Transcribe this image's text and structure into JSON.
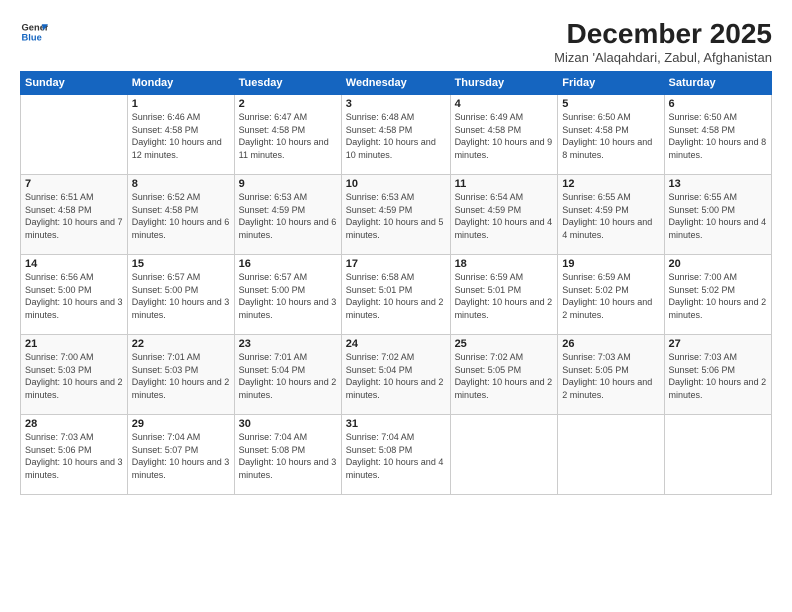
{
  "logo": {
    "line1": "General",
    "line2": "Blue"
  },
  "title": "December 2025",
  "subtitle": "Mizan 'Alaqahdari, Zabul, Afghanistan",
  "days_header": [
    "Sunday",
    "Monday",
    "Tuesday",
    "Wednesday",
    "Thursday",
    "Friday",
    "Saturday"
  ],
  "weeks": [
    [
      {
        "day": "",
        "sunrise": "",
        "sunset": "",
        "daylight": ""
      },
      {
        "day": "1",
        "sunrise": "Sunrise: 6:46 AM",
        "sunset": "Sunset: 4:58 PM",
        "daylight": "Daylight: 10 hours and 12 minutes."
      },
      {
        "day": "2",
        "sunrise": "Sunrise: 6:47 AM",
        "sunset": "Sunset: 4:58 PM",
        "daylight": "Daylight: 10 hours and 11 minutes."
      },
      {
        "day": "3",
        "sunrise": "Sunrise: 6:48 AM",
        "sunset": "Sunset: 4:58 PM",
        "daylight": "Daylight: 10 hours and 10 minutes."
      },
      {
        "day": "4",
        "sunrise": "Sunrise: 6:49 AM",
        "sunset": "Sunset: 4:58 PM",
        "daylight": "Daylight: 10 hours and 9 minutes."
      },
      {
        "day": "5",
        "sunrise": "Sunrise: 6:50 AM",
        "sunset": "Sunset: 4:58 PM",
        "daylight": "Daylight: 10 hours and 8 minutes."
      },
      {
        "day": "6",
        "sunrise": "Sunrise: 6:50 AM",
        "sunset": "Sunset: 4:58 PM",
        "daylight": "Daylight: 10 hours and 8 minutes."
      }
    ],
    [
      {
        "day": "7",
        "sunrise": "Sunrise: 6:51 AM",
        "sunset": "Sunset: 4:58 PM",
        "daylight": "Daylight: 10 hours and 7 minutes."
      },
      {
        "day": "8",
        "sunrise": "Sunrise: 6:52 AM",
        "sunset": "Sunset: 4:58 PM",
        "daylight": "Daylight: 10 hours and 6 minutes."
      },
      {
        "day": "9",
        "sunrise": "Sunrise: 6:53 AM",
        "sunset": "Sunset: 4:59 PM",
        "daylight": "Daylight: 10 hours and 6 minutes."
      },
      {
        "day": "10",
        "sunrise": "Sunrise: 6:53 AM",
        "sunset": "Sunset: 4:59 PM",
        "daylight": "Daylight: 10 hours and 5 minutes."
      },
      {
        "day": "11",
        "sunrise": "Sunrise: 6:54 AM",
        "sunset": "Sunset: 4:59 PM",
        "daylight": "Daylight: 10 hours and 4 minutes."
      },
      {
        "day": "12",
        "sunrise": "Sunrise: 6:55 AM",
        "sunset": "Sunset: 4:59 PM",
        "daylight": "Daylight: 10 hours and 4 minutes."
      },
      {
        "day": "13",
        "sunrise": "Sunrise: 6:55 AM",
        "sunset": "Sunset: 5:00 PM",
        "daylight": "Daylight: 10 hours and 4 minutes."
      }
    ],
    [
      {
        "day": "14",
        "sunrise": "Sunrise: 6:56 AM",
        "sunset": "Sunset: 5:00 PM",
        "daylight": "Daylight: 10 hours and 3 minutes."
      },
      {
        "day": "15",
        "sunrise": "Sunrise: 6:57 AM",
        "sunset": "Sunset: 5:00 PM",
        "daylight": "Daylight: 10 hours and 3 minutes."
      },
      {
        "day": "16",
        "sunrise": "Sunrise: 6:57 AM",
        "sunset": "Sunset: 5:00 PM",
        "daylight": "Daylight: 10 hours and 3 minutes."
      },
      {
        "day": "17",
        "sunrise": "Sunrise: 6:58 AM",
        "sunset": "Sunset: 5:01 PM",
        "daylight": "Daylight: 10 hours and 2 minutes."
      },
      {
        "day": "18",
        "sunrise": "Sunrise: 6:59 AM",
        "sunset": "Sunset: 5:01 PM",
        "daylight": "Daylight: 10 hours and 2 minutes."
      },
      {
        "day": "19",
        "sunrise": "Sunrise: 6:59 AM",
        "sunset": "Sunset: 5:02 PM",
        "daylight": "Daylight: 10 hours and 2 minutes."
      },
      {
        "day": "20",
        "sunrise": "Sunrise: 7:00 AM",
        "sunset": "Sunset: 5:02 PM",
        "daylight": "Daylight: 10 hours and 2 minutes."
      }
    ],
    [
      {
        "day": "21",
        "sunrise": "Sunrise: 7:00 AM",
        "sunset": "Sunset: 5:03 PM",
        "daylight": "Daylight: 10 hours and 2 minutes."
      },
      {
        "day": "22",
        "sunrise": "Sunrise: 7:01 AM",
        "sunset": "Sunset: 5:03 PM",
        "daylight": "Daylight: 10 hours and 2 minutes."
      },
      {
        "day": "23",
        "sunrise": "Sunrise: 7:01 AM",
        "sunset": "Sunset: 5:04 PM",
        "daylight": "Daylight: 10 hours and 2 minutes."
      },
      {
        "day": "24",
        "sunrise": "Sunrise: 7:02 AM",
        "sunset": "Sunset: 5:04 PM",
        "daylight": "Daylight: 10 hours and 2 minutes."
      },
      {
        "day": "25",
        "sunrise": "Sunrise: 7:02 AM",
        "sunset": "Sunset: 5:05 PM",
        "daylight": "Daylight: 10 hours and 2 minutes."
      },
      {
        "day": "26",
        "sunrise": "Sunrise: 7:03 AM",
        "sunset": "Sunset: 5:05 PM",
        "daylight": "Daylight: 10 hours and 2 minutes."
      },
      {
        "day": "27",
        "sunrise": "Sunrise: 7:03 AM",
        "sunset": "Sunset: 5:06 PM",
        "daylight": "Daylight: 10 hours and 2 minutes."
      }
    ],
    [
      {
        "day": "28",
        "sunrise": "Sunrise: 7:03 AM",
        "sunset": "Sunset: 5:06 PM",
        "daylight": "Daylight: 10 hours and 3 minutes."
      },
      {
        "day": "29",
        "sunrise": "Sunrise: 7:04 AM",
        "sunset": "Sunset: 5:07 PM",
        "daylight": "Daylight: 10 hours and 3 minutes."
      },
      {
        "day": "30",
        "sunrise": "Sunrise: 7:04 AM",
        "sunset": "Sunset: 5:08 PM",
        "daylight": "Daylight: 10 hours and 3 minutes."
      },
      {
        "day": "31",
        "sunrise": "Sunrise: 7:04 AM",
        "sunset": "Sunset: 5:08 PM",
        "daylight": "Daylight: 10 hours and 4 minutes."
      },
      {
        "day": "",
        "sunrise": "",
        "sunset": "",
        "daylight": ""
      },
      {
        "day": "",
        "sunrise": "",
        "sunset": "",
        "daylight": ""
      },
      {
        "day": "",
        "sunrise": "",
        "sunset": "",
        "daylight": ""
      }
    ]
  ]
}
